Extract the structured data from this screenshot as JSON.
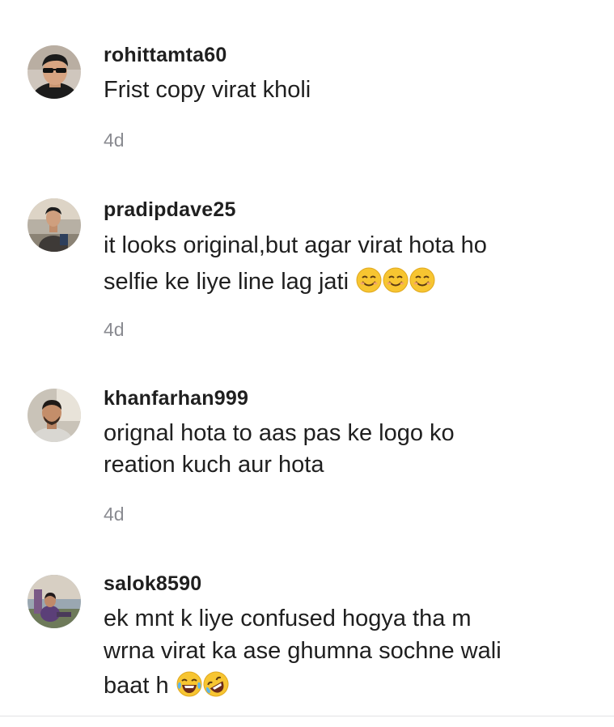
{
  "comments": [
    {
      "username": "rohittamta60",
      "lines": [
        "Frist copy virat kholi"
      ],
      "time": "4d",
      "avatar_icon": "profile-photo-sunglasses"
    },
    {
      "username": "pradipdave25",
      "lines": [
        "it looks original,but agar virat hota ho",
        "selfie ke liye line lag jati"
      ],
      "time": "4d",
      "emojis": [
        "smiling-face-emoji",
        "smiling-face-emoji",
        "smiling-face-emoji"
      ],
      "avatar_icon": "profile-photo-outdoor"
    },
    {
      "username": "khanfarhan999",
      "lines": [
        "orignal hota to aas pas ke logo ko",
        "reation kuch aur hota"
      ],
      "time": "4d",
      "avatar_icon": "profile-photo-beard"
    },
    {
      "username": "salok8590",
      "lines": [
        "ek mnt k liye confused hogya tha m",
        "wrna virat ka ase ghumna sochne wali",
        "baat h"
      ],
      "time": "",
      "emojis": [
        "tears-of-joy-emoji",
        "rolling-laughing-emoji"
      ],
      "avatar_icon": "profile-photo-sitting"
    }
  ],
  "colors": {
    "text": "#1f1f1f",
    "muted": "#8a8b91",
    "divider": "#e3e3e4",
    "emoji": "#f7c531"
  }
}
